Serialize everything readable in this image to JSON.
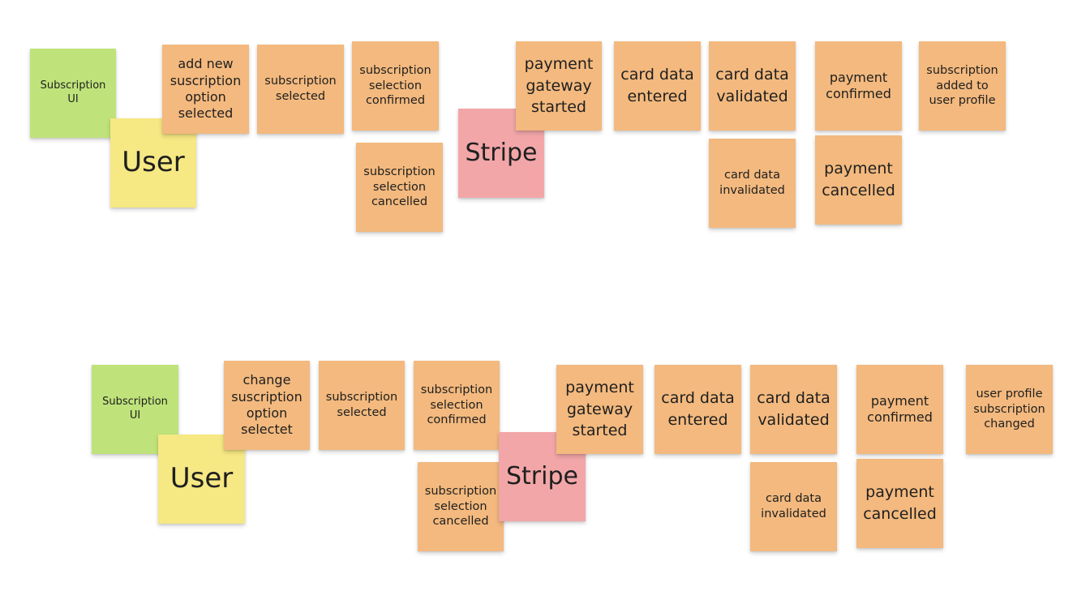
{
  "colors": {
    "event": "#f3b97e",
    "ui": "#bfe37a",
    "actor": "#f6e883",
    "external_system": "#f2a6a8"
  },
  "flows": [
    {
      "notes": {
        "ui": "Subscription UI",
        "actor": "User",
        "e1": "add new suscription option selected",
        "e2": "subscription selected",
        "e3": "subscription selection confirmed",
        "e3_alt": "subscription selection cancelled",
        "system": "Stripe",
        "p1": "payment gateway started",
        "p2": "card data entered",
        "p3": "card data validated",
        "p3_alt": "card data invalidated",
        "p4": "payment confirmed",
        "p4_alt": "payment cancelled",
        "p5": "subscription added to user profile"
      }
    },
    {
      "notes": {
        "ui": "Subscription UI",
        "actor": "User",
        "e1": "change suscription option selectet",
        "e2": "subscription selected",
        "e3": "subscription selection confirmed",
        "e3_alt": "subscription selection cancelled",
        "system": "Stripe",
        "p1": "payment gateway started",
        "p2": "card data entered",
        "p3": "card data validated",
        "p3_alt": "card data invalidated",
        "p4": "payment confirmed",
        "p4_alt": "payment cancelled",
        "p5": "user profile subscription changed"
      }
    }
  ]
}
